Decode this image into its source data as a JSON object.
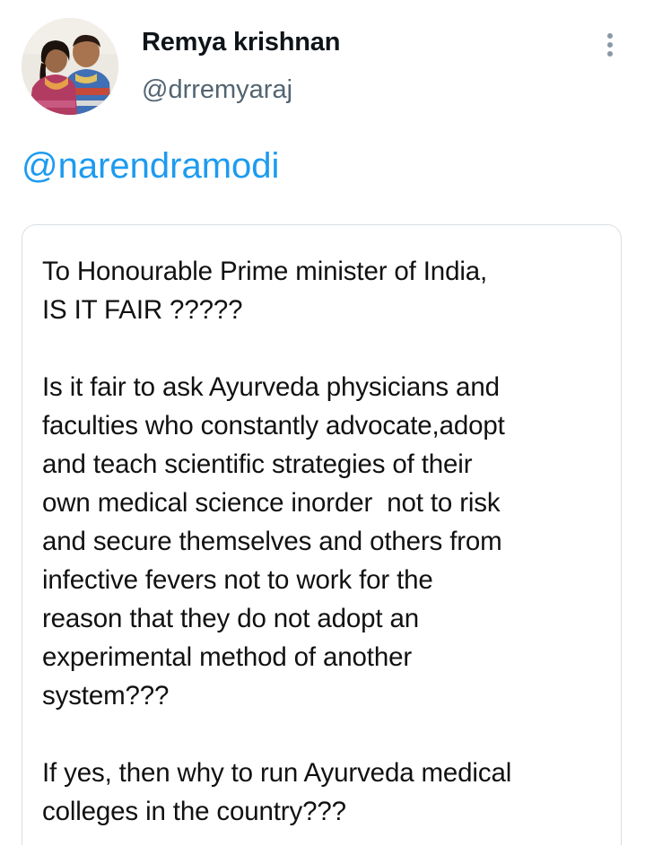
{
  "author": {
    "name": "Remya krishnan",
    "handle": "@drremyaraj",
    "avatar_icon": "profile-photo"
  },
  "more_icon": "more-vertical-icon",
  "mention": "@narendramodi",
  "card": {
    "lines": [
      "To Honourable Prime minister of India,",
      "IS IT FAIR ?????",
      "",
      "Is it fair to ask Ayurveda physicians and",
      "faculties who constantly advocate,adopt",
      "and teach scientific strategies of their",
      "own medical science inorder  not to risk",
      "and secure themselves and others from",
      "infective fevers not to work for the",
      "reason that they do not adopt an",
      "experimental method of another",
      "system???",
      "",
      "If yes, then why to run Ayurveda medical",
      "colleges in the country???"
    ]
  },
  "colors": {
    "link": "#1d9bf0",
    "handle": "#536471",
    "border": "#d8dee3"
  }
}
